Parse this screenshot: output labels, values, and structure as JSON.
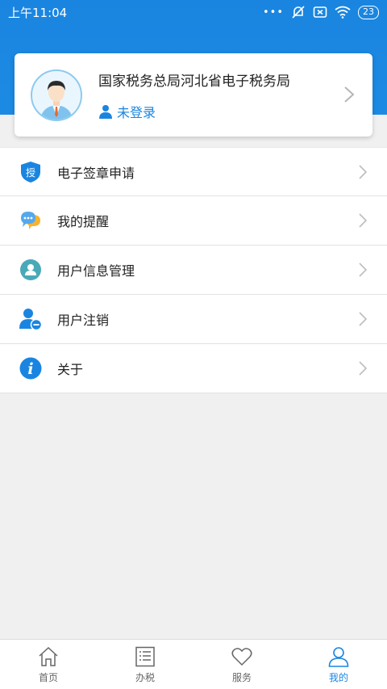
{
  "status_bar": {
    "time": "上午11:04",
    "signal_dots": "•••",
    "battery_level": "23"
  },
  "profile": {
    "org_name": "国家税务总局河北省电子税务局",
    "login_status": "未登录"
  },
  "menu": {
    "items": [
      {
        "label": "电子签章申请",
        "icon": "authorize-shield-icon",
        "badge_text": "授"
      },
      {
        "label": "我的提醒",
        "icon": "chat-bubble-icon"
      },
      {
        "label": "用户信息管理",
        "icon": "user-info-icon"
      },
      {
        "label": "用户注销",
        "icon": "user-remove-icon"
      },
      {
        "label": "关于",
        "icon": "info-icon",
        "badge_text": "i"
      }
    ]
  },
  "tabbar": {
    "tabs": [
      {
        "label": "首页",
        "icon": "home-icon",
        "active": false
      },
      {
        "label": "办税",
        "icon": "list-icon",
        "active": false
      },
      {
        "label": "服务",
        "icon": "heart-icon",
        "active": false
      },
      {
        "label": "我的",
        "icon": "person-icon",
        "active": true
      }
    ]
  },
  "colors": {
    "primary": "#1a85e0",
    "background": "#f0f0f0"
  }
}
